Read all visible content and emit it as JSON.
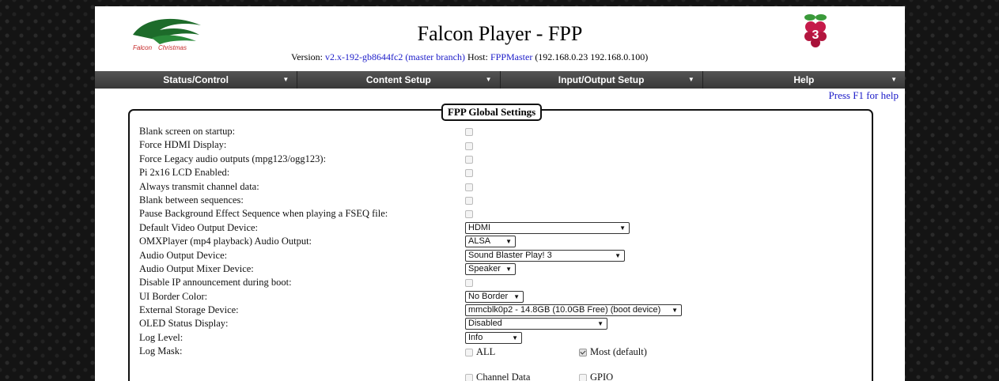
{
  "header": {
    "title": "Falcon Player - FPP",
    "version_prefix": "Version:",
    "version_link": "v2.x-192-gb8644fc2 (master branch)",
    "host_prefix": "Host:",
    "host_link": "FPPMaster",
    "host_ips": "(192.168.0.23 192.168.0.100)",
    "logo_text": "Falcon Christmas"
  },
  "nav": {
    "items": [
      "Status/Control",
      "Content Setup",
      "Input/Output Setup",
      "Help"
    ]
  },
  "help_link": "Press F1 for help",
  "settings": {
    "legend": "FPP Global Settings",
    "rows": [
      {
        "label": "Blank screen on startup:",
        "type": "checkbox",
        "checked": false
      },
      {
        "label": "Force HDMI Display:",
        "type": "checkbox",
        "checked": false
      },
      {
        "label": "Force Legacy audio outputs (mpg123/ogg123):",
        "type": "checkbox",
        "checked": false
      },
      {
        "label": "Pi 2x16 LCD Enabled:",
        "type": "checkbox",
        "checked": false
      },
      {
        "label": "Always transmit channel data:",
        "type": "checkbox",
        "checked": false
      },
      {
        "label": "Blank between sequences:",
        "type": "checkbox",
        "checked": false
      },
      {
        "label": "Pause Background Effect Sequence when playing a FSEQ file:",
        "type": "checkbox",
        "checked": false
      },
      {
        "label": "Default Video Output Device:",
        "type": "select",
        "value": "HDMI"
      },
      {
        "label": "OMXPlayer (mp4 playback) Audio Output:",
        "type": "select",
        "value": "ALSA"
      },
      {
        "label": "Audio Output Device:",
        "type": "select",
        "value": "Sound Blaster Play! 3"
      },
      {
        "label": "Audio Output Mixer Device:",
        "type": "select",
        "value": "Speaker"
      },
      {
        "label": "Disable IP announcement during boot:",
        "type": "checkbox",
        "checked": false
      },
      {
        "label": "UI Border Color:",
        "type": "select",
        "value": "No Border"
      },
      {
        "label": "External Storage Device:",
        "type": "select",
        "value": "mmcblk0p2 - 14.8GB (10.0GB Free) (boot device)"
      },
      {
        "label": "OLED Status Display:",
        "type": "select",
        "value": "Disabled"
      },
      {
        "label": "Log Level:",
        "type": "select",
        "value": "Info"
      },
      {
        "label": "Log Mask:",
        "type": "mask"
      }
    ],
    "log_mask": [
      {
        "label": "ALL",
        "checked": false
      },
      {
        "label": "Most (default)",
        "checked": true
      },
      {
        "label": "Channel Data",
        "checked": false
      },
      {
        "label": "GPIO",
        "checked": false
      }
    ]
  },
  "colors": {
    "link": "#1a1ac8",
    "nav_bg": "#444444",
    "page_bg": "#ffffff"
  }
}
